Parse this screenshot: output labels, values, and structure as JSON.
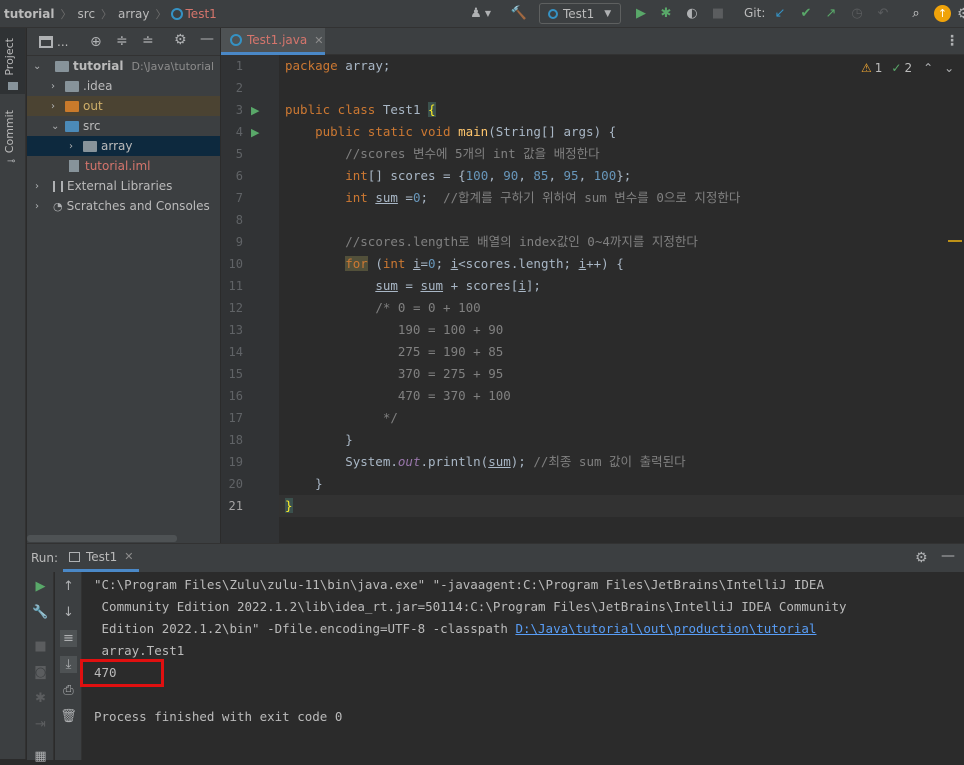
{
  "nav": {
    "breadcrumbs": [
      "tutorial",
      "src",
      "array"
    ],
    "file": "Test1",
    "run_config": "Test1",
    "git_label": "Git:"
  },
  "left_tabs": {
    "project": "Project",
    "commit": "Commit"
  },
  "project": {
    "header": "...",
    "tree": [
      {
        "label": "tutorial",
        "path": "D:\\Java\\tutorial"
      },
      {
        "label": ".idea"
      },
      {
        "label": "out"
      },
      {
        "label": "src"
      },
      {
        "label": "array"
      },
      {
        "label": "tutorial.iml"
      },
      {
        "label": "External Libraries"
      },
      {
        "label": "Scratches and Consoles"
      }
    ]
  },
  "editor": {
    "tab": "Test1.java",
    "warnings": "1",
    "weak_warnings": "2",
    "line_numbers": [
      "1",
      "2",
      "3",
      "4",
      "5",
      "6",
      "7",
      "8",
      "9",
      "10",
      "11",
      "12",
      "13",
      "14",
      "15",
      "16",
      "17",
      "18",
      "19",
      "20",
      "21"
    ]
  },
  "run": {
    "label": "Run:",
    "tab": "Test1",
    "output": [
      "\"C:\\Program Files\\Zulu\\zulu-11\\bin\\java.exe\" \"-javaagent:C:\\Program Files\\JetBrains\\IntelliJ IDEA",
      " Community Edition 2022.1.2\\lib\\idea_rt.jar=50114:C:\\Program Files\\JetBrains\\IntelliJ IDEA Community",
      " Edition 2022.1.2\\bin\" -Dfile.encoding=UTF-8 -classpath ",
      " array.Test1",
      "470",
      "",
      "Process finished with exit code 0"
    ],
    "classpath_link": "D:\\Java\\tutorial\\out\\production\\tutorial"
  },
  "colors": {
    "highlight_box": "#e01010",
    "selected_row": "#0d293e",
    "accent": "#3592c4"
  }
}
